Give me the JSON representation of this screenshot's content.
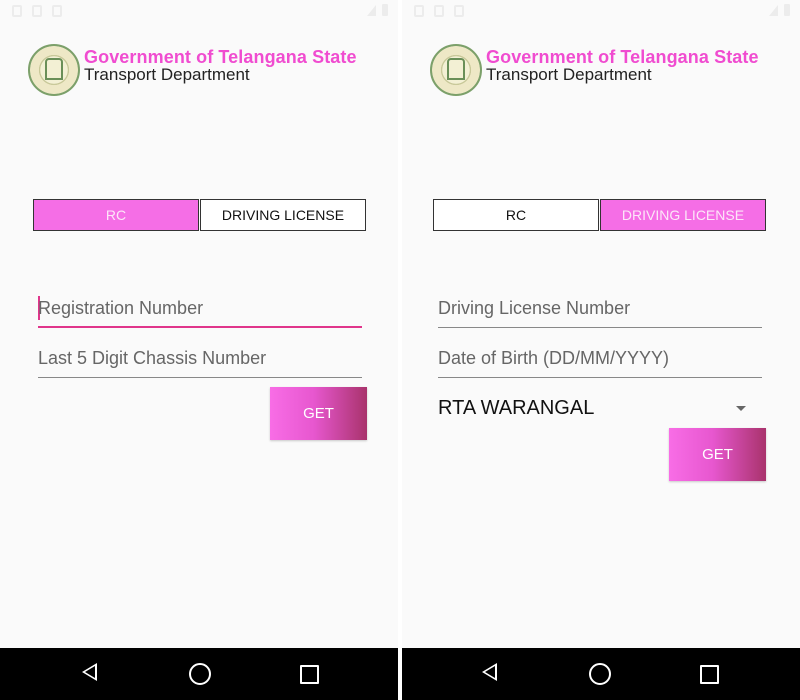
{
  "header": {
    "gov_title": "Government of Telangana State",
    "dept_title": "Transport Department"
  },
  "left": {
    "tabs": [
      {
        "label": "RC",
        "active": true
      },
      {
        "label": "DRIVING LICENSE",
        "active": false
      }
    ],
    "registration_number": {
      "value": "",
      "placeholder": "Registration Number"
    },
    "chassis_number": {
      "value": "",
      "placeholder": "Last 5 Digit Chassis Number"
    },
    "get_label": "GET"
  },
  "right": {
    "tabs": [
      {
        "label": "RC",
        "active": false
      },
      {
        "label": "DRIVING LICENSE",
        "active": true
      }
    ],
    "license_number": {
      "value": "",
      "placeholder": "Driving License Number"
    },
    "date_of_birth": {
      "value": "",
      "placeholder": "Date of Birth (DD/MM/YYYY)"
    },
    "rta_select": {
      "value": "RTA WARANGAL"
    },
    "get_label": "GET"
  },
  "icons": {
    "nav_back": "back-triangle-icon",
    "nav_home": "home-circle-icon",
    "nav_recents": "recents-square-icon",
    "dropdown": "chevron-down-icon",
    "logo": "telangana-emblem"
  },
  "colors": {
    "accent_pink": "#f56ee6",
    "focus_underline": "#e0358b",
    "title_pink": "#f04cd0",
    "button_gradient_end": "#a9336c"
  }
}
